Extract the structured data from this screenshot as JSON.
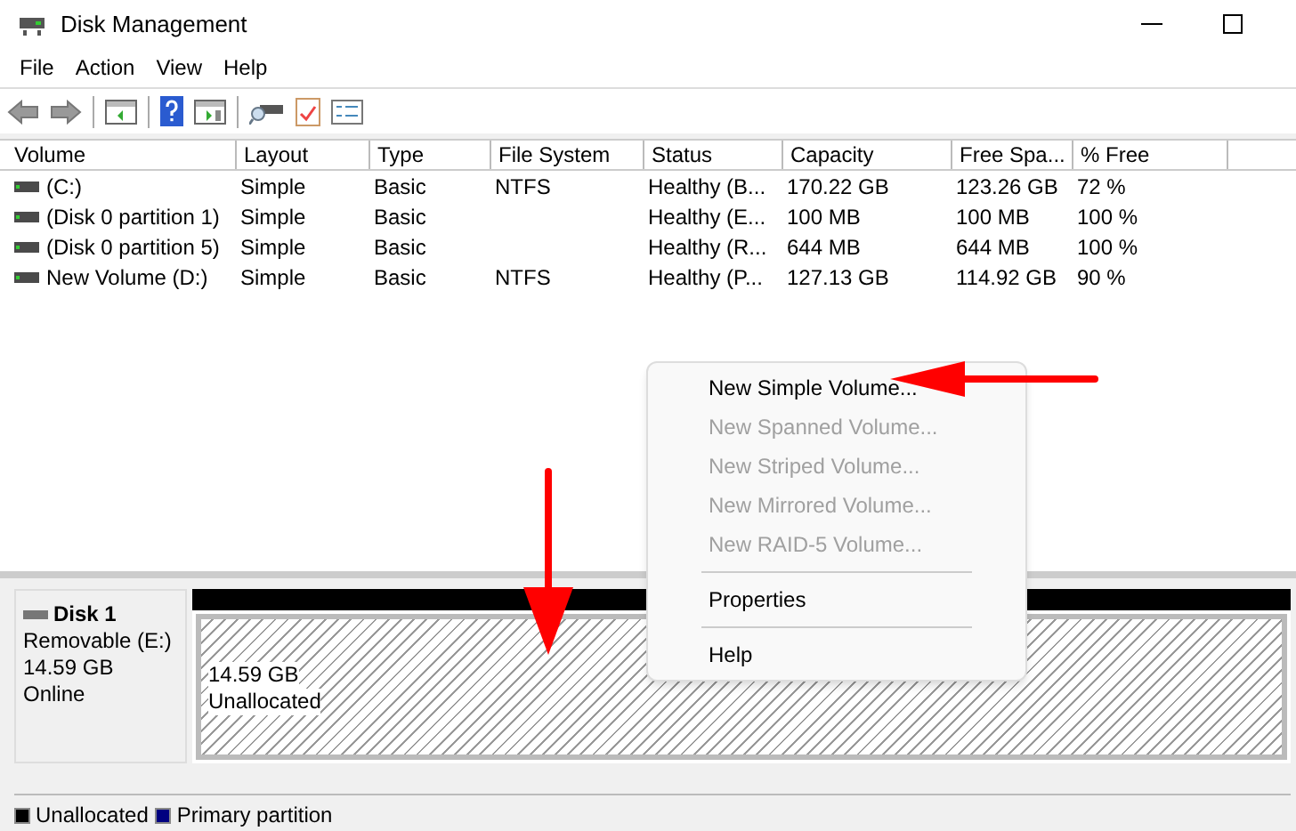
{
  "window": {
    "title": "Disk Management"
  },
  "menu": [
    "File",
    "Action",
    "View",
    "Help"
  ],
  "table": {
    "columns": [
      "Volume",
      "Layout",
      "Type",
      "File System",
      "Status",
      "Capacity",
      "Free Spa...",
      "% Free"
    ],
    "rows": [
      [
        "(C:)",
        "Simple",
        "Basic",
        "NTFS",
        "Healthy (B...",
        "170.22 GB",
        "123.26 GB",
        "72 %"
      ],
      [
        "(Disk 0 partition 1)",
        "Simple",
        "Basic",
        "",
        "Healthy (E...",
        "100 MB",
        "100 MB",
        "100 %"
      ],
      [
        "(Disk 0 partition 5)",
        "Simple",
        "Basic",
        "",
        "Healthy (R...",
        "644 MB",
        "644 MB",
        "100 %"
      ],
      [
        "New Volume (D:)",
        "Simple",
        "Basic",
        "NTFS",
        "Healthy (P...",
        "127.13 GB",
        "114.92 GB",
        "90 %"
      ]
    ]
  },
  "disk": {
    "name": "Disk 1",
    "type": "Removable (E:)",
    "size": "14.59 GB",
    "status": "Online",
    "partition": {
      "size": "14.59 GB",
      "label": "Unallocated"
    }
  },
  "context_menu": [
    {
      "label": "New Simple Volume...",
      "disabled": false,
      "kind": "item"
    },
    {
      "label": "New Spanned Volume...",
      "disabled": true,
      "kind": "item"
    },
    {
      "label": "New Striped Volume...",
      "disabled": true,
      "kind": "item"
    },
    {
      "label": "New Mirrored Volume...",
      "disabled": true,
      "kind": "item"
    },
    {
      "label": "New RAID-5 Volume...",
      "disabled": true,
      "kind": "item"
    },
    {
      "kind": "separator"
    },
    {
      "label": "Properties",
      "disabled": false,
      "kind": "item"
    },
    {
      "kind": "separator"
    },
    {
      "label": "Help",
      "disabled": false,
      "kind": "item"
    }
  ],
  "legend": [
    {
      "label": "Unallocated",
      "color": "#000000"
    },
    {
      "label": "Primary partition",
      "color": "#000080"
    }
  ]
}
